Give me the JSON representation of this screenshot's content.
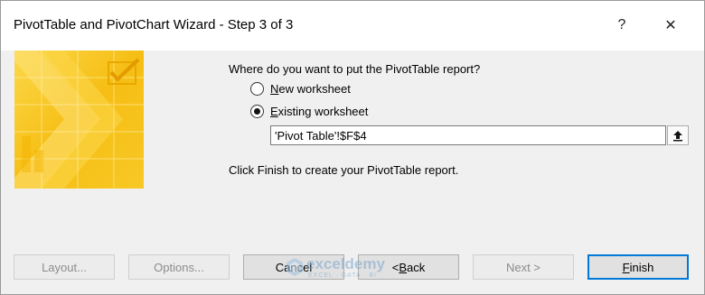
{
  "window": {
    "title": "PivotTable and PivotChart Wizard - Step 3 of 3",
    "help_glyph": "?",
    "close_glyph": "✕"
  },
  "question": "Where do you want to put the PivotTable report?",
  "options": [
    {
      "label": "New worksheet",
      "mnemonic": "N",
      "rest": "ew worksheet",
      "checked": false
    },
    {
      "label": "Existing worksheet",
      "mnemonic": "E",
      "rest": "xisting worksheet",
      "checked": true
    }
  ],
  "reference_input": {
    "value": "'Pivot Table'!$F$4"
  },
  "hint": "Click Finish to create your PivotTable report.",
  "buttons": {
    "layout": "Layout...",
    "options": "Options...",
    "cancel": "Cancel",
    "back": {
      "prefix": "< ",
      "mnemonic": "B",
      "rest": "ack"
    },
    "next": "Next >",
    "finish": {
      "mnemonic": "F",
      "rest": "inish"
    }
  },
  "watermark": {
    "name": "exceldemy",
    "tagline": "EXCEL · DATA · BI"
  },
  "colors": {
    "accent": "#0078d7",
    "art_yellow": "#f7c21b",
    "art_light": "#fbe27a"
  },
  "icons": {
    "help": "help-icon",
    "close": "close-icon",
    "collapse": "collapse-dialog-icon"
  }
}
